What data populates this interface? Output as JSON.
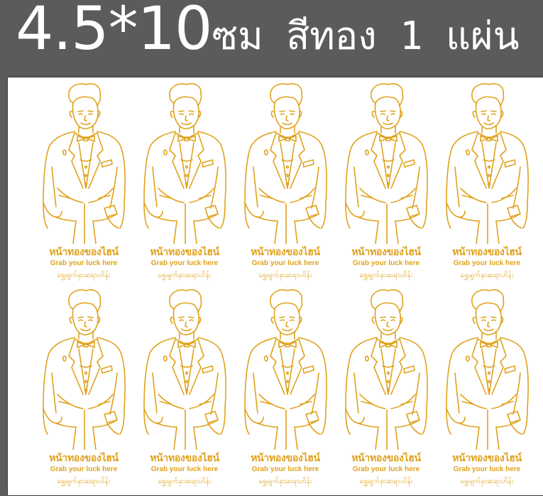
{
  "header": {
    "title_big": "4.5*10",
    "title_rest": "ซม สีทอง 1 แผ่น"
  },
  "sticker": {
    "thai_text": "หน้าทองของไฮน์",
    "english_text": "Grab your luck here",
    "burmese_text": "ရွှေမျက်နှာဆရာဟိန်း",
    "figure": "man-in-suit-line-drawing",
    "ink_color": "#e0a21c"
  },
  "sheet": {
    "rows": 2,
    "columns": 5,
    "stickers": [
      {},
      {},
      {},
      {},
      {},
      {},
      {},
      {},
      {},
      {}
    ]
  }
}
